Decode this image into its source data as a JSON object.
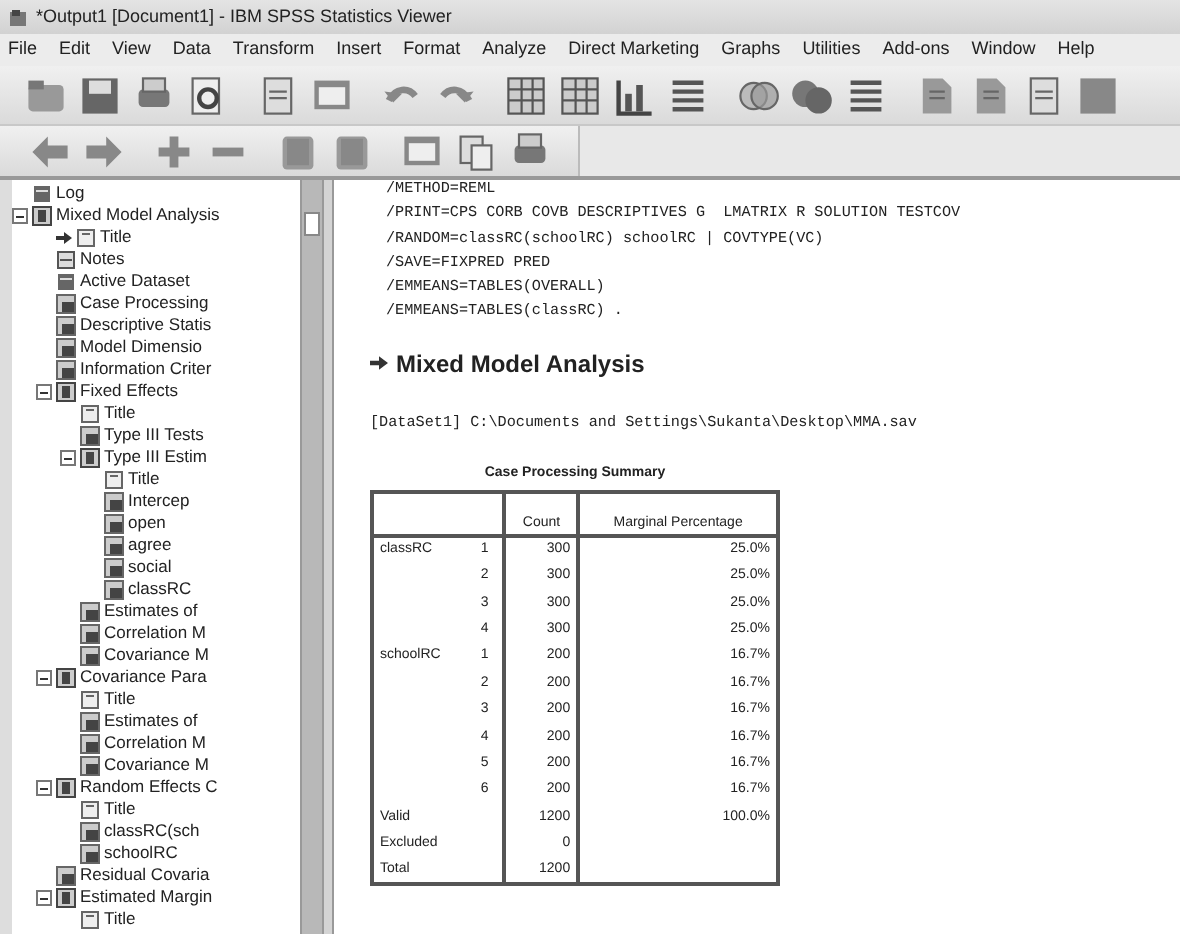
{
  "window": {
    "title": "*Output1 [Document1] - IBM SPSS Statistics Viewer"
  },
  "menu": [
    "File",
    "Edit",
    "View",
    "Data",
    "Transform",
    "Insert",
    "Format",
    "Analyze",
    "Direct Marketing",
    "Graphs",
    "Utilities",
    "Add-ons",
    "Window",
    "Help"
  ],
  "outline": [
    {
      "label": "Log",
      "kind": "log",
      "marked": false
    },
    {
      "label": "Mixed Model Analysis",
      "kind": "book",
      "marked": false,
      "expanded": true,
      "children": [
        {
          "label": "Title",
          "kind": "title",
          "marked": true
        },
        {
          "label": "Notes",
          "kind": "notes",
          "marked": false
        },
        {
          "label": "Active Dataset",
          "kind": "log",
          "marked": false
        },
        {
          "label": "Case Processing",
          "kind": "table",
          "marked": false
        },
        {
          "label": "Descriptive Statis",
          "kind": "table",
          "marked": false
        },
        {
          "label": "Model Dimensio",
          "kind": "table",
          "marked": false
        },
        {
          "label": "Information Criter",
          "kind": "table",
          "marked": false
        },
        {
          "label": "Fixed Effects",
          "kind": "book",
          "marked": false,
          "expanded": true,
          "children": [
            {
              "label": "Title",
              "kind": "title",
              "marked": false
            },
            {
              "label": "Type III Tests",
              "kind": "table",
              "marked": false
            },
            {
              "label": "Type III Estim",
              "kind": "book",
              "marked": false,
              "expanded": true,
              "children": [
                {
                  "label": "Title",
                  "kind": "title",
                  "marked": false
                },
                {
                  "label": "Intercep",
                  "kind": "table",
                  "marked": false
                },
                {
                  "label": "open",
                  "kind": "table",
                  "marked": false
                },
                {
                  "label": "agree",
                  "kind": "table",
                  "marked": false
                },
                {
                  "label": "social",
                  "kind": "table",
                  "marked": false
                },
                {
                  "label": "classRC",
                  "kind": "table",
                  "marked": false
                }
              ]
            },
            {
              "label": "Estimates of",
              "kind": "table",
              "marked": false
            },
            {
              "label": "Correlation M",
              "kind": "table",
              "marked": false
            },
            {
              "label": "Covariance M",
              "kind": "table",
              "marked": false
            }
          ]
        },
        {
          "label": "Covariance Para",
          "kind": "book",
          "marked": false,
          "expanded": true,
          "children": [
            {
              "label": "Title",
              "kind": "title",
              "marked": false
            },
            {
              "label": "Estimates of",
              "kind": "table",
              "marked": false
            },
            {
              "label": "Correlation M",
              "kind": "table",
              "marked": false
            },
            {
              "label": "Covariance M",
              "kind": "table",
              "marked": false
            }
          ]
        },
        {
          "label": "Random Effects C",
          "kind": "book",
          "marked": false,
          "expanded": true,
          "children": [
            {
              "label": "Title",
              "kind": "title",
              "marked": false
            },
            {
              "label": "classRC(sch",
              "kind": "table",
              "marked": false
            },
            {
              "label": "schoolRC",
              "kind": "table",
              "marked": false
            }
          ]
        },
        {
          "label": "Residual Covaria",
          "kind": "table",
          "marked": false
        },
        {
          "label": "Estimated Margin",
          "kind": "book",
          "marked": false,
          "expanded": true,
          "children": [
            {
              "label": "Title",
              "kind": "title",
              "marked": false
            }
          ]
        }
      ]
    }
  ],
  "syntax": [
    "/METHOD=REML",
    "/PRINT=CPS CORB COVB DESCRIPTIVES G  LMATRIX R SOLUTION TESTCOV",
    "/RANDOM=classRC(schoolRC) schoolRC | COVTYPE(VC)",
    "/SAVE=FIXPRED PRED",
    "/EMMEANS=TABLES(OVERALL)",
    "/EMMEANS=TABLES(classRC) ."
  ],
  "heading": {
    "text": "Mixed Model Analysis",
    "marked": true
  },
  "dataset_line": "[DataSet1] C:\\Documents and Settings\\Sukanta\\Desktop\\MMA.sav",
  "table": {
    "title": "Case Processing Summary",
    "columns": [
      "",
      "",
      "Count",
      "Marginal Percentage"
    ],
    "rows": [
      [
        "classRC",
        "1",
        "300",
        "25.0%"
      ],
      [
        "",
        "2",
        "300",
        "25.0%"
      ],
      [
        "",
        "3",
        "300",
        "25.0%"
      ],
      [
        "",
        "4",
        "300",
        "25.0%"
      ],
      [
        "schoolRC",
        "1",
        "200",
        "16.7%"
      ],
      [
        "",
        "2",
        "200",
        "16.7%"
      ],
      [
        "",
        "3",
        "200",
        "16.7%"
      ],
      [
        "",
        "4",
        "200",
        "16.7%"
      ],
      [
        "",
        "5",
        "200",
        "16.7%"
      ],
      [
        "",
        "6",
        "200",
        "16.7%"
      ],
      [
        "Valid",
        "",
        "1200",
        "100.0%"
      ],
      [
        "Excluded",
        "",
        "0",
        ""
      ],
      [
        "Total",
        "",
        "1200",
        ""
      ]
    ]
  }
}
